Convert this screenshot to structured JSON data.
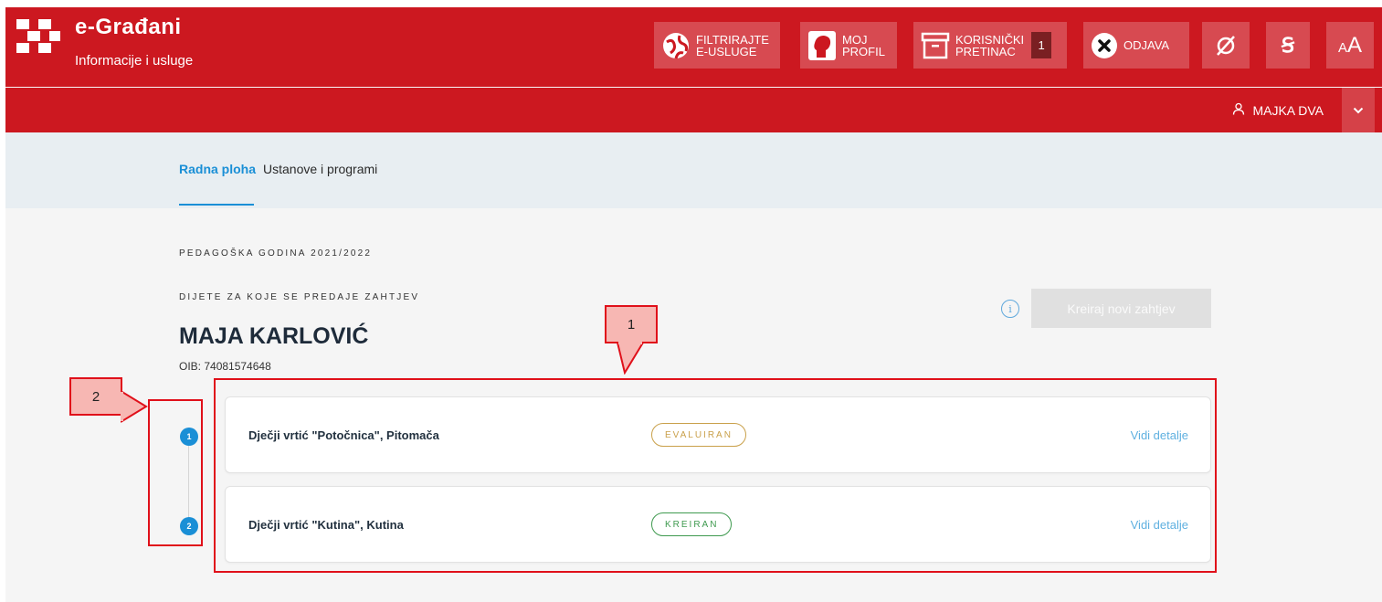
{
  "header": {
    "brand_title": "e-Građani",
    "brand_subtitle": "Informacije i usluge",
    "buttons": [
      {
        "icon": "globe-filter-icon",
        "label_line1": "FILTRIRAJTE",
        "label_line2": "E-USLUGE"
      },
      {
        "icon": "profile-icon",
        "label_line1": "MOJ",
        "label_line2": "PROFIL"
      },
      {
        "icon": "inbox-icon",
        "label_line1": "KORISNIČKI",
        "label_line2": "PRETINAC",
        "count": "1"
      },
      {
        "icon": "close-circle-icon",
        "label": "ODJAVA"
      },
      {
        "icon": "hide-visibility-icon"
      },
      {
        "icon": "dyslexia-font-icon",
        "glyph": "Ꞩ"
      },
      {
        "icon": "font-size-icon",
        "glyph_small": "A",
        "glyph_large": "A"
      }
    ],
    "user_name": "MAJKA DVA"
  },
  "tabs": [
    {
      "label": "Radna ploha",
      "active": true
    },
    {
      "label": "Ustanove i programi",
      "active": false
    }
  ],
  "main": {
    "year_label": "PEDAGOŠKA GODINA 2021/2022",
    "child_label": "DIJETE ZA KOJE SE PREDAJE ZAHTJEV",
    "child_name": "MAJA KARLOVIĆ",
    "oib": "OIB: 74081574648",
    "create_button": "Kreiraj novi zahtjev",
    "info_glyph": "i"
  },
  "requests": [
    {
      "step": "1",
      "name": "Dječji vrtić \"Potočnica\", Pitomača",
      "status": "EVALUIRAN",
      "status_color": "#c9a04a",
      "details": "Vidi detalje"
    },
    {
      "step": "2",
      "name": "Dječji vrtić \"Kutina\", Kutina",
      "status": "KREIRAN",
      "status_color": "#3f9a4f",
      "details": "Vidi detalje"
    }
  ],
  "annotations": {
    "callout_1": "1",
    "callout_2": "2"
  },
  "colors": {
    "brand_red": "#cc1820",
    "accent_blue": "#1a8fd6",
    "annotation_red": "#e0101a"
  }
}
